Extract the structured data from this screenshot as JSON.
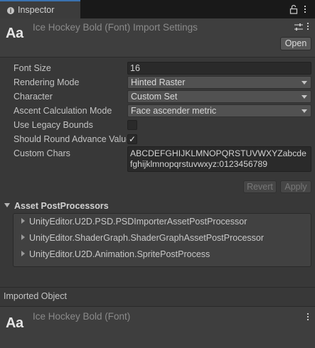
{
  "tab": {
    "title": "Inspector"
  },
  "header": {
    "icon_text": "Aa",
    "title": "Ice Hockey Bold (Font) Import Settings",
    "open_label": "Open"
  },
  "properties": {
    "font_size": {
      "label": "Font Size",
      "value": "16"
    },
    "rendering_mode": {
      "label": "Rendering Mode",
      "value": "Hinted Raster"
    },
    "character": {
      "label": "Character",
      "value": "Custom Set"
    },
    "ascent": {
      "label": "Ascent Calculation Mode",
      "value": "Face ascender metric"
    },
    "legacy_bounds": {
      "label": "Use Legacy Bounds",
      "checked": false
    },
    "round_advance": {
      "label": "Should Round Advance Value",
      "checked": true
    },
    "custom_chars": {
      "label": "Custom Chars",
      "value": "ABCDEFGHIJKLMNOPQRSTUVWXYZabcdefghijklmnopqrstuvwxyz:0123456789"
    }
  },
  "actions": {
    "revert_label": "Revert",
    "apply_label": "Apply"
  },
  "postprocessors": {
    "title": "Asset PostProcessors",
    "items": [
      "UnityEditor.U2D.PSD.PSDImporterAssetPostProcessor",
      "UnityEditor.ShaderGraph.ShaderGraphAssetPostProcessor",
      "UnityEditor.U2D.Animation.SpritePostProcess"
    ]
  },
  "imported": {
    "section_label": "Imported Object",
    "icon_text": "Aa",
    "title": "Ice Hockey Bold (Font)"
  },
  "icons": [
    "info-icon",
    "lock-icon",
    "kebab-menu-icon",
    "preset-sliders-icon",
    "foldout-arrow-icon"
  ],
  "colors": {
    "background": "#383838",
    "header": "#3e3e3e",
    "tab_accent": "#3a72b0",
    "field": "#2a2a2a",
    "dropdown": "#515151"
  }
}
